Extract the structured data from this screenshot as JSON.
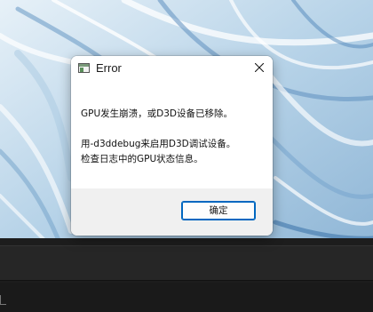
{
  "dialog": {
    "title": "Error",
    "close_icon": "close-icon",
    "app_icon": "window-app-icon",
    "message": {
      "line1": "GPU发生崩溃，或D3D设备已移除。",
      "line2": "用-d3ddebug来启用D3D调试设备。",
      "line3": "检查日志中的GPU状态信息。"
    },
    "ok_label": "确定"
  },
  "colors": {
    "accent": "#0067c0",
    "footer_bg": "#f0f0f0",
    "taskbar": "#1d1d1d"
  }
}
